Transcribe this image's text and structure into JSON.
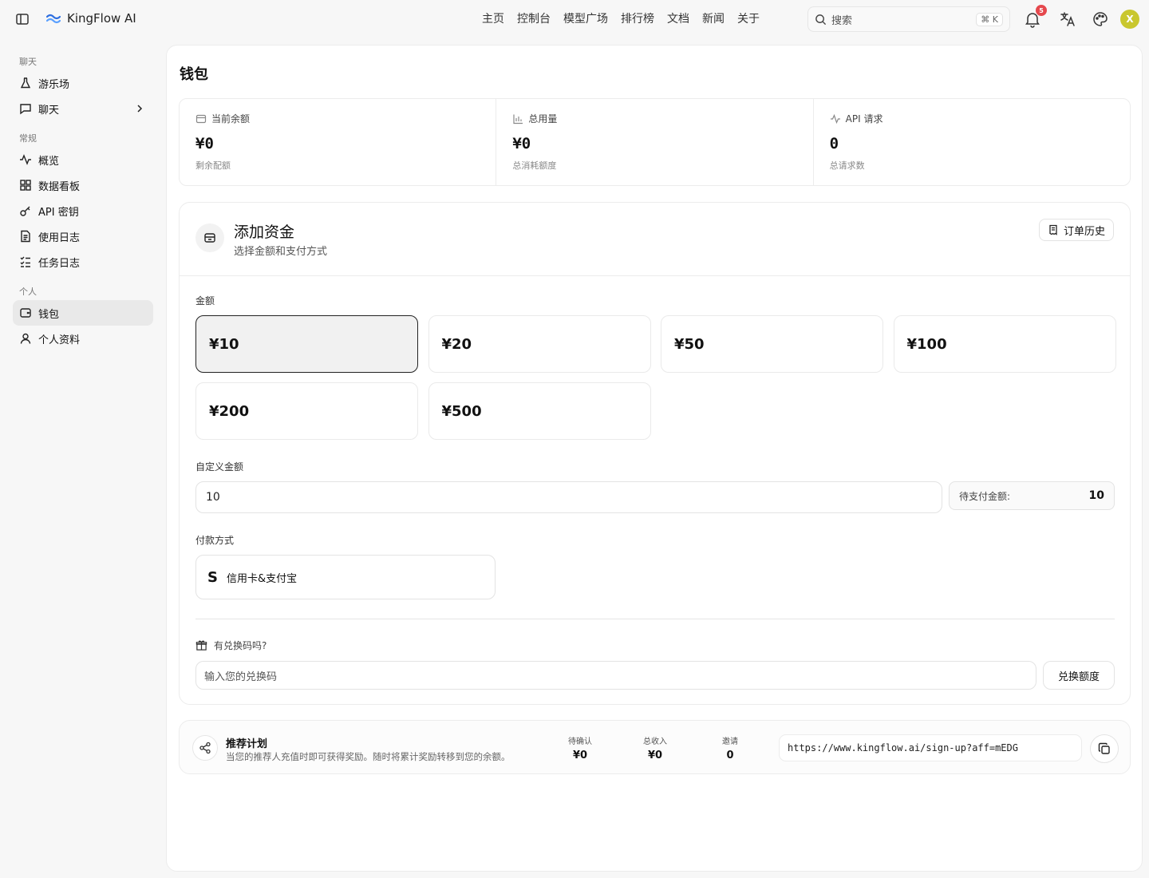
{
  "app": {
    "name": "KingFlow AI"
  },
  "nav": [
    "主页",
    "控制台",
    "模型广场",
    "排行榜",
    "文档",
    "新闻",
    "关于"
  ],
  "search": {
    "placeholder": "搜索",
    "shortcut": "⌘ K"
  },
  "notifications": {
    "count": "5"
  },
  "user": {
    "initial": "X"
  },
  "sidebar": {
    "groups": [
      {
        "label": "聊天",
        "items": [
          "游乐场",
          "聊天"
        ]
      },
      {
        "label": "常规",
        "items": [
          "概览",
          "数据看板",
          "API 密钥",
          "使用日志",
          "任务日志"
        ]
      },
      {
        "label": "个人",
        "items": [
          "钱包",
          "个人资料"
        ]
      }
    ],
    "active": "钱包"
  },
  "page": {
    "title": "钱包"
  },
  "stats": [
    {
      "label": "当前余额",
      "value": "¥0",
      "sub": "剩余配额"
    },
    {
      "label": "总用量",
      "value": "¥0",
      "sub": "总消耗额度"
    },
    {
      "label": "API 请求",
      "value": "0",
      "sub": "总请求数"
    }
  ],
  "fund": {
    "title": "添加资金",
    "subtitle": "选择金额和支付方式",
    "order_history": "订单历史",
    "amount_label": "金额",
    "amounts": [
      "¥10",
      "¥20",
      "¥50",
      "¥100",
      "¥200",
      "¥500"
    ],
    "selected_amount": "¥10",
    "custom_label": "自定义金额",
    "custom_value": "10",
    "pay_amount_label": "待支付金额:",
    "pay_amount_value": "10",
    "method_label": "付款方式",
    "method": "信用卡&支付宝",
    "redeem_question": "有兑换码吗?",
    "redeem_placeholder": "输入您的兑换码",
    "redeem_button": "兑换额度"
  },
  "referral": {
    "title": "推荐计划",
    "desc": "当您的推荐人充值时即可获得奖励。随时将累计奖励转移到您的余额。",
    "stats": [
      {
        "label": "待确认",
        "value": "¥0"
      },
      {
        "label": "总收入",
        "value": "¥0"
      },
      {
        "label": "邀请",
        "value": "0"
      }
    ],
    "link": "https://www.kingflow.ai/sign-up?aff=mEDG"
  }
}
